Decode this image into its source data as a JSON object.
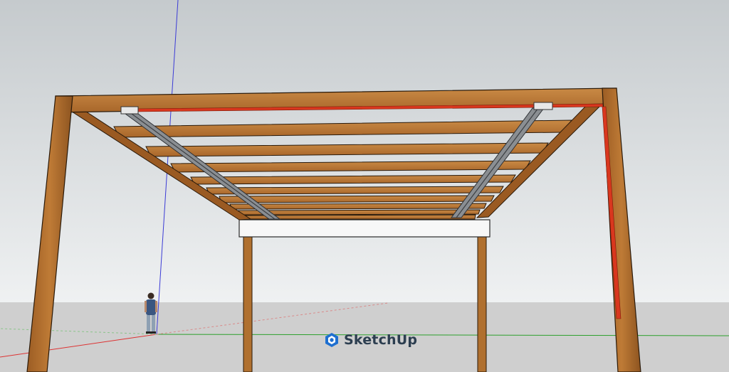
{
  "app": {
    "watermark_text": "SketchUp",
    "logo_icon": "sketchup-logo-icon"
  },
  "colors": {
    "sky_top": "#c9ced1",
    "sky_bottom": "#eef0f1",
    "ground": "#cfcfcf",
    "wood": "#b8732e",
    "wood_dark": "#8f561f",
    "wood_light": "#c98a45",
    "beam_white": "#f7f7f7",
    "track": "#777b80",
    "track_dark": "#3c3f43",
    "red_strip": "#d9371e",
    "axis_blue": "#3b3bd6",
    "axis_red": "#d33",
    "axis_green": "#2da02d",
    "logo_blue": "#1e6fd0"
  }
}
